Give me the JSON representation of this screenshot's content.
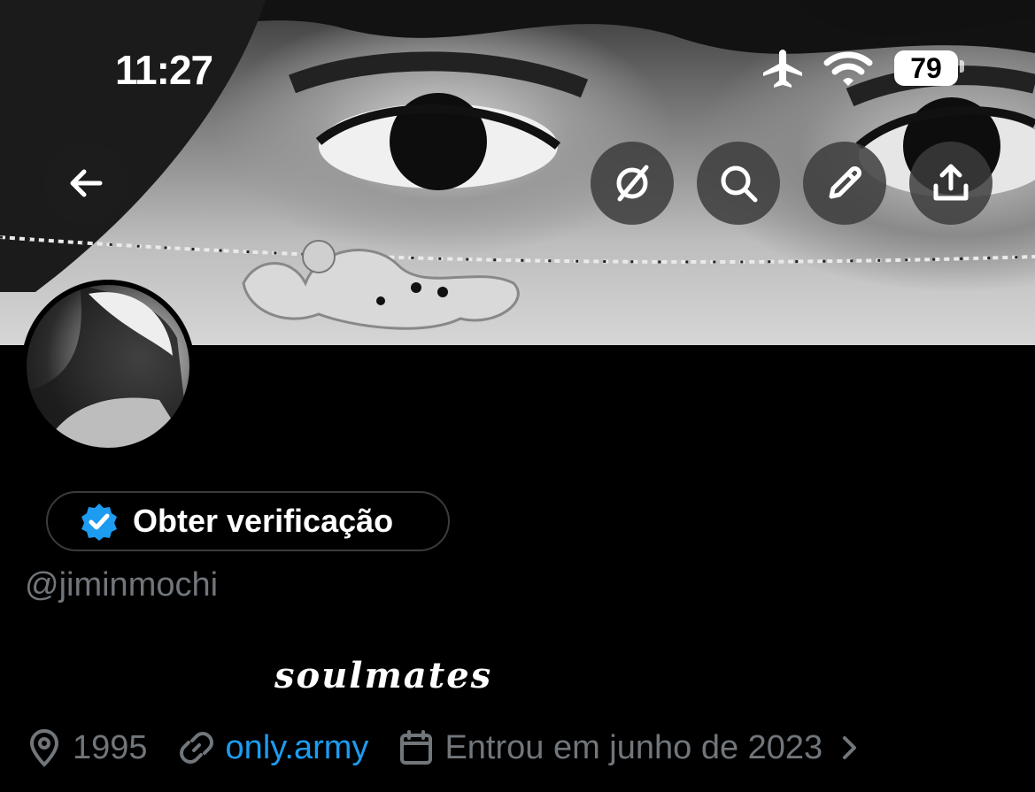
{
  "status_bar": {
    "time": "11:27",
    "battery": "79",
    "icons": [
      "airplane-mode-icon",
      "wifi-icon",
      "battery-icon"
    ]
  },
  "header_actions": {
    "back": "arrow-left-icon",
    "grok": "grok-icon",
    "search": "search-icon",
    "edit": "pencil-icon",
    "share": "share-icon"
  },
  "profile": {
    "verify_label": "Obter verificação",
    "handle": "@jiminmochi",
    "bio": "soulmates",
    "location": "1995",
    "website": "only.army",
    "joined": "Entrou em junho de 2023"
  },
  "colors": {
    "link": "#1d9bf0",
    "muted": "#71767b",
    "verified_badge": "#1d9bf0",
    "background": "#000000"
  }
}
